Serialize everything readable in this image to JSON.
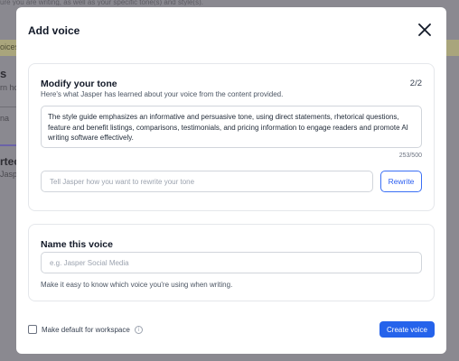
{
  "background": {
    "topline": "ure you are writing, as well as your specific tone(s) and style(s).",
    "yellow_banner": "oices",
    "heading_s": "s",
    "subtext_rn": "rn ho",
    "subtext_na": "na",
    "heading_rtec": "rtec",
    "subtext_jasp": "Jasp"
  },
  "modal": {
    "title": "Add voice",
    "close_icon": "close-icon",
    "tone_card": {
      "title": "Modify your tone",
      "page_count": "2/2",
      "subtitle": "Here's what Jasper has learned about your voice from the content provided.",
      "tone_text": "The style guide emphasizes an informative and persuasive tone, using direct statements, rhetorical questions, feature and benefit listings, comparisons, testimonials, and pricing information to engage readers and promote AI writing software effectively.",
      "char_count": "253/500",
      "rewrite_placeholder": "Tell Jasper how you want to rewrite your tone",
      "rewrite_value": "",
      "rewrite_button": "Rewrite"
    },
    "name_card": {
      "title": "Name this voice",
      "placeholder": "e.g. Jasper Social Media",
      "value": "",
      "help": "Make it easy to know which voice you're using when writing."
    },
    "footer": {
      "checkbox_label": "Make default for workspace",
      "checkbox_checked": false,
      "info_icon": "info-icon",
      "create_button": "Create voice"
    }
  },
  "colors": {
    "accent": "#2563eb",
    "overlay": "#8a8990",
    "banner": "#a9a57c"
  }
}
